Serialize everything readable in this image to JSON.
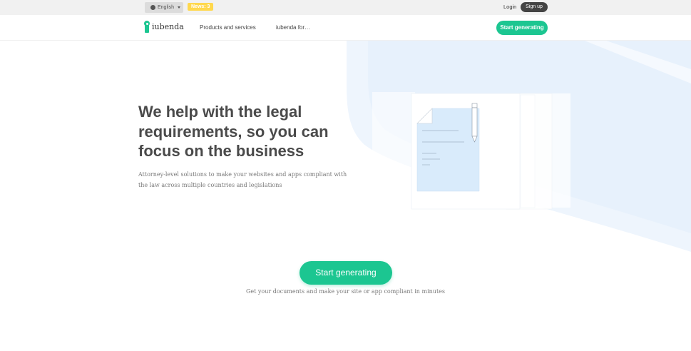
{
  "topbar": {
    "language": "English",
    "news_badge": "News: 3",
    "login": "Login",
    "signup": "Sign up"
  },
  "nav": {
    "logo_text": "iubenda",
    "links": [
      "Products and services",
      "iubenda for…"
    ],
    "cta": "Start generating"
  },
  "hero": {
    "headline": "We help with the legal requirements, so you can focus on the business",
    "subtitle": "Attorney-level solutions to make your websites and apps compliant with the law across multiple countries and legislations"
  },
  "main_cta": {
    "button": "Start generating",
    "note": "Get your documents and make your site or app compliant in minutes"
  },
  "colors": {
    "brand_green": "#1cc691",
    "news_yellow": "#ffd84d",
    "illustration_blue": "#d9ebfb"
  },
  "icons": [
    "globe-icon",
    "caret-down-icon",
    "iubenda-logo-icon",
    "document-illustration",
    "pencil-icon"
  ]
}
